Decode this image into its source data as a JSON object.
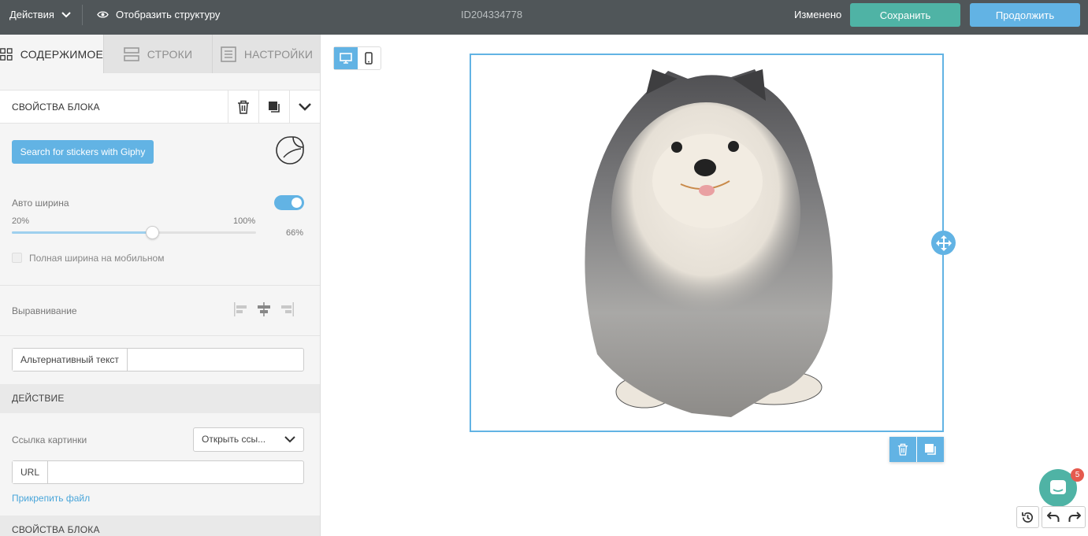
{
  "topbar": {
    "actions_label": "Действия",
    "preview_label": "Отобразить структуру",
    "doc_id": "ID204334778",
    "status": "Изменено",
    "save_label": "Сохранить",
    "continue_label": "Продолжить"
  },
  "tabs": [
    {
      "label": "СОДЕРЖИМОЕ",
      "active": true,
      "icon": "grid-icon"
    },
    {
      "label": "СТРОКИ",
      "active": false,
      "icon": "rows-icon"
    },
    {
      "label": "НАСТРОЙКИ",
      "active": false,
      "icon": "settings-doc-icon"
    }
  ],
  "block": {
    "title": "СВОЙСТВА БЛОКА",
    "giphy_label": "Search for stickers with Giphy",
    "auto_width_label": "Авто ширина",
    "auto_width_on": true,
    "slider_min": "20%",
    "slider_max": "100%",
    "slider_value": "66%",
    "slider_fraction": 0.66,
    "full_width_mobile_label": "Полная ширина на мобильном",
    "align_label": "Выравнивание",
    "alt_text_label": "Альтернативный текст",
    "alt_text_value": ""
  },
  "action": {
    "title": "ДЕЙСТВИЕ",
    "image_link_label": "Ссылка картинки",
    "image_link_selected": "Открыть ссы...",
    "url_label": "URL",
    "url_value": "",
    "attach_label": "Прикрепить файл"
  },
  "bottom_section_title": "СВОЙСТВА БЛОКА",
  "canvas": {
    "image_subject": "watercolor fluffy dog sticker",
    "chat_badge": "5"
  },
  "colors": {
    "topbar": "#505659",
    "accent_blue": "#62b3e4",
    "accent_teal": "#4fb3a5"
  }
}
